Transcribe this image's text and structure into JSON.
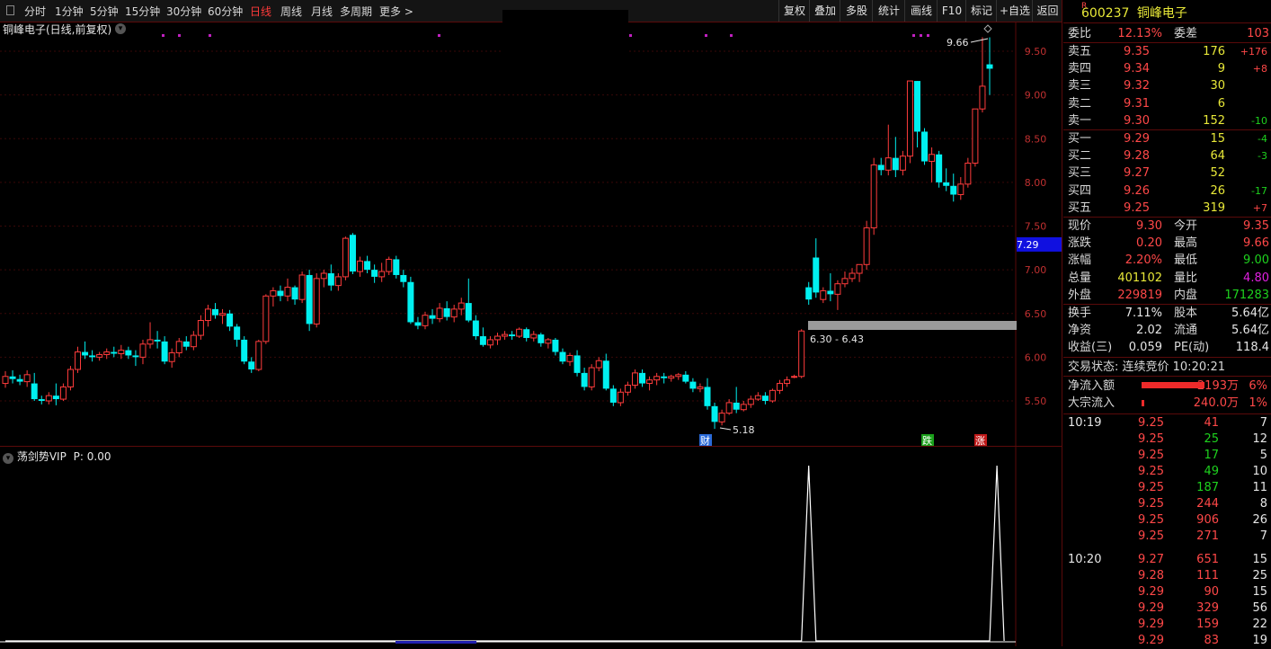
{
  "toolbar": {
    "periods": [
      "分时",
      "1分钟",
      "5分钟",
      "15分钟",
      "30分钟",
      "60分钟",
      "日线",
      "周线",
      "月线",
      "多周期",
      "更多 >"
    ],
    "active": "日线",
    "right_buttons": [
      "复权",
      "叠加",
      "多股",
      "统计",
      "画线",
      "F10",
      "标记",
      "+自选",
      "返回"
    ]
  },
  "chart": {
    "title": "铜峰电子(日线,前复权)",
    "price_axis": [
      "9.50",
      "9.00",
      "8.50",
      "8.00",
      "7.50",
      "7.00",
      "6.50",
      "6.00",
      "5.50"
    ],
    "current_price_tag": "7.29",
    "high_label": "9.66",
    "low_label": "5.18",
    "range_label": "6.30 - 6.43",
    "markers": [
      "财",
      "跌",
      "涨"
    ],
    "colors": {
      "up": "#ff3c3c",
      "down": "#00f0f0",
      "accent": "#ff3a3a"
    }
  },
  "chart_data": {
    "type": "candlestick",
    "candles": [
      [
        5.7,
        5.84,
        5.65,
        5.78
      ],
      [
        5.78,
        5.85,
        5.7,
        5.75
      ],
      [
        5.75,
        5.8,
        5.68,
        5.72
      ],
      [
        5.72,
        5.85,
        5.66,
        5.8
      ],
      [
        5.7,
        5.82,
        5.5,
        5.52
      ],
      [
        5.52,
        5.56,
        5.46,
        5.5
      ],
      [
        5.5,
        5.6,
        5.46,
        5.56
      ],
      [
        5.56,
        5.7,
        5.45,
        5.52
      ],
      [
        5.52,
        5.7,
        5.5,
        5.66
      ],
      [
        5.66,
        5.9,
        5.62,
        5.86
      ],
      [
        5.86,
        6.12,
        5.82,
        6.06
      ],
      [
        6.06,
        6.18,
        5.98,
        6.02
      ],
      [
        6.02,
        6.08,
        5.95,
        6.0
      ],
      [
        6.0,
        6.06,
        5.96,
        6.03
      ],
      [
        6.03,
        6.1,
        5.98,
        6.06
      ],
      [
        6.06,
        6.12,
        6.0,
        6.04
      ],
      [
        6.04,
        6.14,
        5.98,
        6.08
      ],
      [
        6.08,
        6.12,
        5.98,
        6.02
      ],
      [
        6.02,
        6.08,
        5.9,
        6.0
      ],
      [
        6.0,
        6.2,
        5.92,
        6.15
      ],
      [
        6.15,
        6.4,
        6.1,
        6.2
      ],
      [
        6.2,
        6.3,
        6.1,
        6.18
      ],
      [
        6.18,
        6.24,
        5.92,
        5.95
      ],
      [
        5.95,
        6.1,
        5.88,
        6.05
      ],
      [
        6.05,
        6.22,
        6.0,
        6.18
      ],
      [
        6.18,
        6.24,
        6.08,
        6.12
      ],
      [
        6.12,
        6.3,
        6.08,
        6.25
      ],
      [
        6.25,
        6.48,
        6.2,
        6.42
      ],
      [
        6.42,
        6.6,
        6.35,
        6.55
      ],
      [
        6.55,
        6.62,
        6.44,
        6.48
      ],
      [
        6.48,
        6.55,
        6.38,
        6.5
      ],
      [
        6.5,
        6.54,
        6.3,
        6.35
      ],
      [
        6.35,
        6.38,
        6.12,
        6.2
      ],
      [
        6.2,
        6.24,
        5.92,
        5.95
      ],
      [
        5.95,
        6.0,
        5.82,
        5.86
      ],
      [
        5.86,
        6.2,
        5.84,
        6.18
      ],
      [
        6.18,
        6.72,
        6.15,
        6.7
      ],
      [
        6.7,
        6.8,
        6.58,
        6.76
      ],
      [
        6.76,
        6.82,
        6.64,
        6.7
      ],
      [
        6.7,
        6.9,
        6.64,
        6.8
      ],
      [
        6.8,
        6.82,
        6.6,
        6.66
      ],
      [
        6.66,
        6.98,
        6.62,
        6.94
      ],
      [
        6.94,
        7.0,
        6.3,
        6.38
      ],
      [
        6.38,
        6.96,
        6.34,
        6.9
      ],
      [
        6.9,
        7.0,
        6.8,
        6.96
      ],
      [
        6.96,
        7.06,
        6.76,
        6.82
      ],
      [
        6.82,
        6.96,
        6.76,
        6.92
      ],
      [
        6.92,
        7.38,
        6.88,
        7.36
      ],
      [
        7.4,
        7.42,
        6.95,
        6.98
      ],
      [
        6.98,
        7.15,
        6.92,
        7.1
      ],
      [
        7.1,
        7.16,
        6.96,
        7.0
      ],
      [
        7.0,
        7.06,
        6.85,
        6.92
      ],
      [
        6.92,
        7.08,
        6.86,
        6.98
      ],
      [
        6.98,
        7.15,
        6.94,
        7.12
      ],
      [
        7.12,
        7.16,
        6.9,
        6.94
      ],
      [
        6.94,
        7.0,
        6.8,
        6.86
      ],
      [
        6.86,
        6.92,
        6.38,
        6.4
      ],
      [
        6.4,
        6.46,
        6.32,
        6.36
      ],
      [
        6.36,
        6.52,
        6.32,
        6.48
      ],
      [
        6.48,
        6.55,
        6.38,
        6.44
      ],
      [
        6.44,
        6.62,
        6.4,
        6.56
      ],
      [
        6.56,
        6.64,
        6.42,
        6.46
      ],
      [
        6.46,
        6.6,
        6.4,
        6.55
      ],
      [
        6.55,
        6.68,
        6.48,
        6.62
      ],
      [
        6.62,
        6.9,
        6.4,
        6.42
      ],
      [
        6.42,
        6.48,
        6.2,
        6.24
      ],
      [
        6.24,
        6.34,
        6.12,
        6.14
      ],
      [
        6.14,
        6.24,
        6.1,
        6.2
      ],
      [
        6.2,
        6.28,
        6.14,
        6.24
      ],
      [
        6.24,
        6.3,
        6.2,
        6.26
      ],
      [
        6.26,
        6.3,
        6.2,
        6.24
      ],
      [
        6.24,
        6.34,
        6.22,
        6.32
      ],
      [
        6.32,
        6.34,
        6.18,
        6.22
      ],
      [
        6.22,
        6.3,
        6.18,
        6.26
      ],
      [
        6.26,
        6.28,
        6.12,
        6.16
      ],
      [
        6.16,
        6.22,
        6.1,
        6.2
      ],
      [
        6.2,
        6.22,
        6.02,
        6.06
      ],
      [
        6.06,
        6.1,
        5.92,
        5.95
      ],
      [
        5.95,
        6.05,
        5.9,
        6.02
      ],
      [
        6.02,
        6.08,
        5.78,
        5.82
      ],
      [
        5.82,
        5.88,
        5.62,
        5.66
      ],
      [
        5.66,
        5.92,
        5.62,
        5.88
      ],
      [
        5.88,
        6.0,
        5.84,
        5.96
      ],
      [
        5.96,
        6.04,
        5.62,
        5.64
      ],
      [
        5.64,
        5.68,
        5.44,
        5.48
      ],
      [
        5.48,
        5.64,
        5.44,
        5.6
      ],
      [
        5.6,
        5.72,
        5.56,
        5.68
      ],
      [
        5.68,
        5.86,
        5.64,
        5.82
      ],
      [
        5.82,
        5.86,
        5.66,
        5.7
      ],
      [
        5.7,
        5.78,
        5.62,
        5.74
      ],
      [
        5.74,
        5.82,
        5.68,
        5.78
      ],
      [
        5.78,
        5.82,
        5.7,
        5.76
      ],
      [
        5.76,
        5.8,
        5.72,
        5.78
      ],
      [
        5.78,
        5.82,
        5.74,
        5.8
      ],
      [
        5.8,
        5.84,
        5.7,
        5.72
      ],
      [
        5.72,
        5.76,
        5.6,
        5.64
      ],
      [
        5.64,
        5.7,
        5.6,
        5.66
      ],
      [
        5.66,
        5.76,
        5.4,
        5.44
      ],
      [
        5.44,
        5.48,
        5.18,
        5.26
      ],
      [
        5.26,
        5.4,
        5.22,
        5.36
      ],
      [
        5.36,
        5.52,
        5.34,
        5.48
      ],
      [
        5.48,
        5.66,
        5.36,
        5.4
      ],
      [
        5.4,
        5.5,
        5.38,
        5.46
      ],
      [
        5.46,
        5.56,
        5.42,
        5.52
      ],
      [
        5.52,
        5.6,
        5.5,
        5.56
      ],
      [
        5.56,
        5.6,
        5.46,
        5.5
      ],
      [
        5.5,
        5.64,
        5.48,
        5.62
      ],
      [
        5.62,
        5.74,
        5.58,
        5.7
      ],
      [
        5.7,
        5.78,
        5.66,
        5.74
      ],
      [
        5.78,
        5.8,
        5.76,
        5.78
      ],
      [
        5.78,
        6.32,
        5.76,
        6.3
      ],
      [
        6.8,
        6.86,
        6.6,
        6.66
      ],
      [
        7.14,
        7.36,
        6.68,
        6.74
      ],
      [
        6.66,
        6.8,
        6.62,
        6.76
      ],
      [
        6.76,
        6.96,
        6.64,
        6.72
      ],
      [
        6.72,
        6.88,
        6.54,
        6.84
      ],
      [
        6.84,
        6.98,
        6.8,
        6.9
      ],
      [
        6.9,
        7.02,
        6.86,
        6.96
      ],
      [
        6.96,
        7.06,
        6.86,
        7.06
      ],
      [
        7.06,
        7.56,
        7.0,
        7.48
      ],
      [
        7.48,
        8.28,
        7.4,
        8.2
      ],
      [
        8.2,
        8.28,
        8.08,
        8.14
      ],
      [
        8.14,
        8.66,
        8.08,
        8.28
      ],
      [
        8.28,
        8.52,
        8.06,
        8.14
      ],
      [
        8.14,
        8.36,
        8.08,
        8.3
      ],
      [
        8.3,
        9.16,
        8.22,
        9.16
      ],
      [
        9.16,
        9.16,
        8.4,
        8.58
      ],
      [
        8.58,
        8.62,
        8.2,
        8.24
      ],
      [
        8.24,
        8.4,
        8.0,
        8.32
      ],
      [
        8.32,
        8.36,
        7.94,
        8.0
      ],
      [
        8.0,
        8.16,
        7.9,
        7.96
      ],
      [
        7.96,
        8.1,
        7.78,
        7.86
      ],
      [
        7.86,
        8.06,
        7.8,
        7.98
      ],
      [
        7.98,
        8.28,
        7.94,
        8.22
      ],
      [
        8.22,
        8.84,
        8.18,
        8.84
      ],
      [
        8.84,
        9.66,
        8.8,
        9.1
      ],
      [
        9.35,
        9.66,
        9.0,
        9.3
      ]
    ],
    "indicator": {
      "name": "荡剑势VIP",
      "param": "P: 0.00",
      "signal": [
        0,
        0,
        0,
        0,
        0,
        0,
        0,
        0,
        0,
        0,
        0,
        0,
        0,
        0,
        0,
        0,
        0,
        0,
        0,
        0,
        0,
        0,
        0,
        0,
        0,
        0,
        0,
        0,
        0,
        0,
        0,
        0,
        0,
        0,
        0,
        0,
        0,
        0,
        0,
        0,
        0,
        0,
        0,
        0,
        0,
        0,
        0,
        0,
        0,
        0,
        0,
        0,
        0,
        0,
        0,
        0,
        0,
        0,
        0,
        0,
        0,
        0,
        0,
        0,
        0,
        0,
        0,
        0,
        0,
        0,
        0,
        0,
        0,
        0,
        0,
        0,
        0,
        0,
        0,
        0,
        0,
        0,
        0,
        0,
        0,
        0,
        0,
        0,
        0,
        0,
        0,
        0,
        0,
        0,
        0,
        0,
        0,
        0,
        0,
        0,
        0,
        0,
        0,
        0,
        0,
        0,
        0,
        0,
        0,
        0,
        0,
        1,
        0,
        0,
        0,
        0,
        0,
        0,
        0,
        0,
        0,
        0,
        0,
        0,
        0,
        0,
        0,
        0,
        0,
        0,
        0,
        0,
        0,
        0,
        0,
        0,
        0,
        1,
        0
      ]
    }
  },
  "panel": {
    "code": "600237",
    "name": "铜峰电子",
    "r_badge": "R",
    "weibi": {
      "label": "委比",
      "value": "12.13%",
      "label2": "委差",
      "value2": "103"
    },
    "sells": [
      {
        "label": "卖五",
        "price": "9.35",
        "vol": "176",
        "chg": "+176"
      },
      {
        "label": "卖四",
        "price": "9.34",
        "vol": "9",
        "chg": "+8"
      },
      {
        "label": "卖三",
        "price": "9.32",
        "vol": "30",
        "chg": ""
      },
      {
        "label": "卖二",
        "price": "9.31",
        "vol": "6",
        "chg": ""
      },
      {
        "label": "卖一",
        "price": "9.30",
        "vol": "152",
        "chg": "-10"
      }
    ],
    "buys": [
      {
        "label": "买一",
        "price": "9.29",
        "vol": "15",
        "chg": "-4"
      },
      {
        "label": "买二",
        "price": "9.28",
        "vol": "64",
        "chg": "-3"
      },
      {
        "label": "买三",
        "price": "9.27",
        "vol": "52",
        "chg": ""
      },
      {
        "label": "买四",
        "price": "9.26",
        "vol": "26",
        "chg": "-17"
      },
      {
        "label": "买五",
        "price": "9.25",
        "vol": "319",
        "chg": "+7"
      }
    ],
    "stats": [
      {
        "l1": "现价",
        "v1": "9.30",
        "c1": "red",
        "l2": "今开",
        "v2": "9.35",
        "c2": "red"
      },
      {
        "l1": "涨跌",
        "v1": "0.20",
        "c1": "red",
        "l2": "最高",
        "v2": "9.66",
        "c2": "red"
      },
      {
        "l1": "涨幅",
        "v1": "2.20%",
        "c1": "red",
        "l2": "最低",
        "v2": "9.00",
        "c2": "grn"
      },
      {
        "l1": "总量",
        "v1": "401102",
        "c1": "yel",
        "l2": "量比",
        "v2": "4.80",
        "c2": "mag"
      },
      {
        "l1": "外盘",
        "v1": "229819",
        "c1": "red",
        "l2": "内盘",
        "v2": "171283",
        "c2": "grn"
      }
    ],
    "stats2": [
      {
        "l1": "换手",
        "v1": "7.11%",
        "l2": "股本",
        "v2": "5.64亿"
      },
      {
        "l1": "净资",
        "v1": "2.02",
        "l2": "流通",
        "v2": "5.64亿"
      },
      {
        "l1": "收益(三)",
        "v1": "0.059",
        "l2": "PE(动)",
        "v2": "118.4"
      }
    ],
    "trade_status": "交易状态: 连续竞价 10:20:21",
    "flows": [
      {
        "label": "净流入额",
        "value": "2193万",
        "pct": "6%"
      },
      {
        "label": "大宗流入",
        "value": "240.0万",
        "pct": "1%"
      }
    ],
    "ticks": [
      {
        "time": "10:19",
        "price": "9.25",
        "vol": "41",
        "vc": "red",
        "n": "7"
      },
      {
        "time": "",
        "price": "9.25",
        "vol": "25",
        "vc": "grn",
        "n": "12"
      },
      {
        "time": "",
        "price": "9.25",
        "vol": "17",
        "vc": "grn",
        "n": "5"
      },
      {
        "time": "",
        "price": "9.25",
        "vol": "49",
        "vc": "grn",
        "n": "10"
      },
      {
        "time": "",
        "price": "9.25",
        "vol": "187",
        "vc": "grn",
        "n": "11"
      },
      {
        "time": "",
        "price": "9.25",
        "vol": "244",
        "vc": "red",
        "n": "8"
      },
      {
        "time": "",
        "price": "9.25",
        "vol": "906",
        "vc": "red",
        "n": "26"
      },
      {
        "time": "",
        "price": "9.25",
        "vol": "271",
        "vc": "red",
        "n": "7"
      },
      {
        "time": "10:20",
        "price": "9.27",
        "vol": "651",
        "vc": "red",
        "n": "15"
      },
      {
        "time": "",
        "price": "9.28",
        "vol": "111",
        "vc": "red",
        "n": "25"
      },
      {
        "time": "",
        "price": "9.29",
        "vol": "90",
        "vc": "red",
        "n": "15"
      },
      {
        "time": "",
        "price": "9.29",
        "vol": "329",
        "vc": "red",
        "n": "56"
      },
      {
        "time": "",
        "price": "9.29",
        "vol": "159",
        "vc": "red",
        "n": "22"
      },
      {
        "time": "",
        "price": "9.29",
        "vol": "83",
        "vc": "red",
        "n": "19"
      }
    ]
  }
}
